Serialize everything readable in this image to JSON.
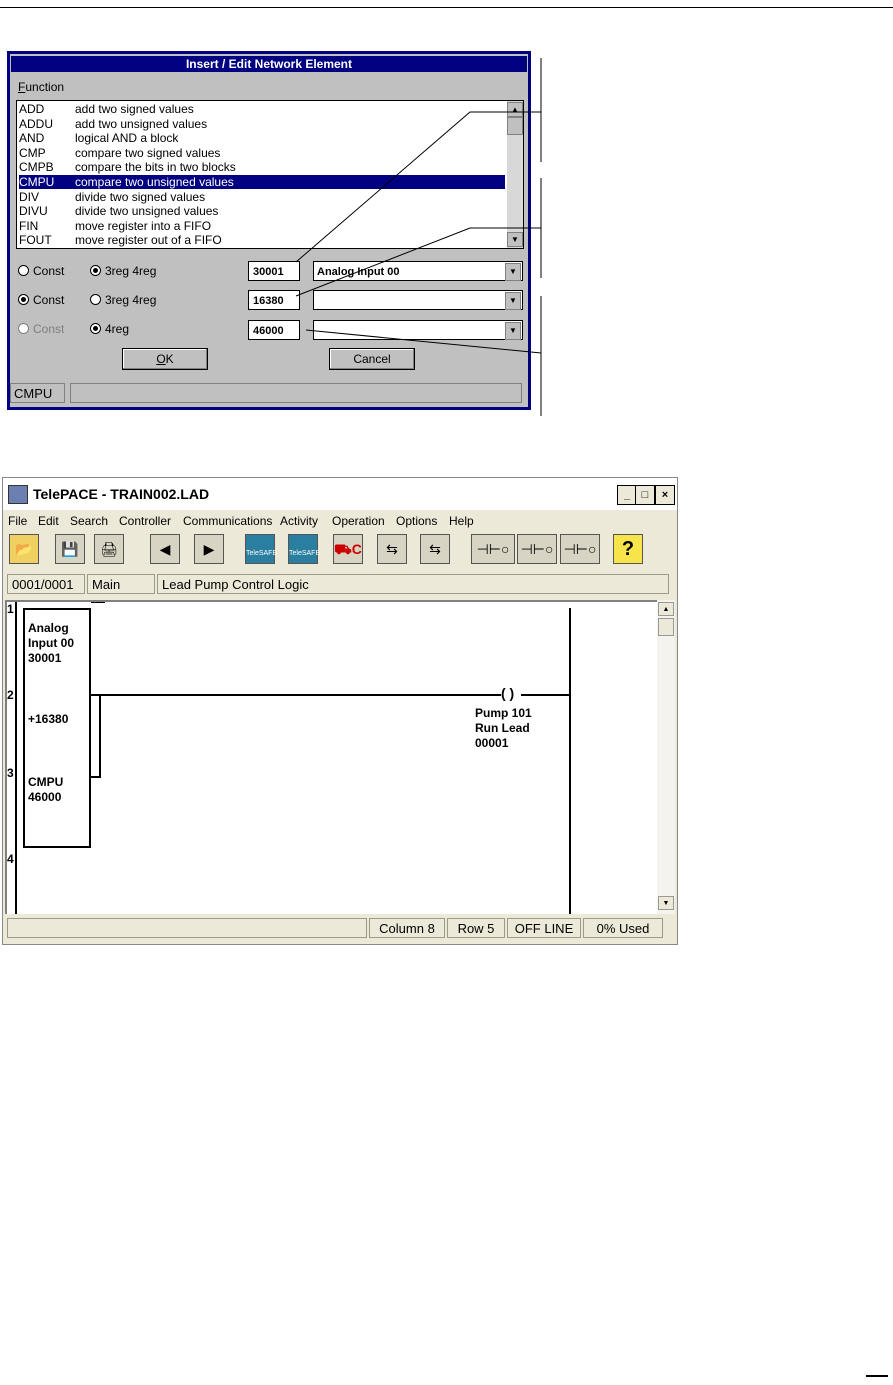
{
  "dialog": {
    "title": "Insert / Edit Network Element",
    "function_label_underline": "F",
    "function_label_rest": "unction",
    "functions": [
      {
        "code": "ADD",
        "desc": "add two signed values"
      },
      {
        "code": "ADDU",
        "desc": "add two unsigned values"
      },
      {
        "code": "AND",
        "desc": "logical AND a block"
      },
      {
        "code": "CMP",
        "desc": "compare two signed values"
      },
      {
        "code": "CMPB",
        "desc": "compare the bits in two blocks"
      },
      {
        "code": "CMPU",
        "desc": "compare two unsigned values"
      },
      {
        "code": "DIV",
        "desc": "divide two signed values"
      },
      {
        "code": "DIVU",
        "desc": "divide two unsigned values"
      },
      {
        "code": "FIN",
        "desc": "move register into a FIFO"
      },
      {
        "code": "FOUT",
        "desc": "move register out of a FIFO"
      }
    ],
    "selected_function": "CMPU",
    "rows": [
      {
        "const_label": "Const",
        "reg_label": "3reg 4reg",
        "value": "30001",
        "combo": "Analog Input 00",
        "const_selected": false,
        "reg_selected": true,
        "const_disabled": false
      },
      {
        "const_label": "Const",
        "reg_label": "3reg 4reg",
        "value": "16380",
        "combo": "",
        "const_selected": true,
        "reg_selected": false,
        "const_disabled": false
      },
      {
        "const_label": "Const",
        "reg_label": "4reg",
        "value": "46000",
        "combo": "",
        "const_selected": false,
        "reg_selected": true,
        "const_disabled": true
      }
    ],
    "ok_underline": "O",
    "ok_rest": "K",
    "cancel": "Cancel",
    "status": "CMPU"
  },
  "window": {
    "title": "TelePACE - TRAIN002.LAD",
    "controls": {
      "minimize": "_",
      "maximize": "□",
      "close": "×"
    },
    "menu": [
      "File",
      "Edit",
      "Search",
      "Controller",
      "Communications",
      "Activity",
      "Operation",
      "Options",
      "Help"
    ],
    "toolbar": {
      "open_icon": "folder-open-icon",
      "save_icon": "floppy-icon",
      "print_icon": "printer-icon",
      "prev_icon": "triangle-left-icon",
      "next_icon": "triangle-right-icon",
      "telesafe_label": "TeleSAFE",
      "controller_c": "C",
      "help_glyph": "?"
    },
    "info": {
      "network": "0001/0001",
      "section": "Main",
      "comment": "Lead Pump Control Logic"
    },
    "ladder": {
      "rungs": [
        "1",
        "2",
        "3",
        "4"
      ],
      "block_lines": {
        "top": [
          "Analog",
          "Input 00",
          "30001"
        ],
        "middle": [
          "+16380"
        ],
        "bottom": [
          "CMPU",
          "46000"
        ]
      },
      "coil_symbol": "( )",
      "coil_lines": [
        "Pump 101",
        "Run Lead",
        "00001"
      ]
    },
    "status": {
      "col": "Column 8",
      "row": "Row 5",
      "mode": "OFF LINE",
      "used": "0% Used"
    }
  }
}
